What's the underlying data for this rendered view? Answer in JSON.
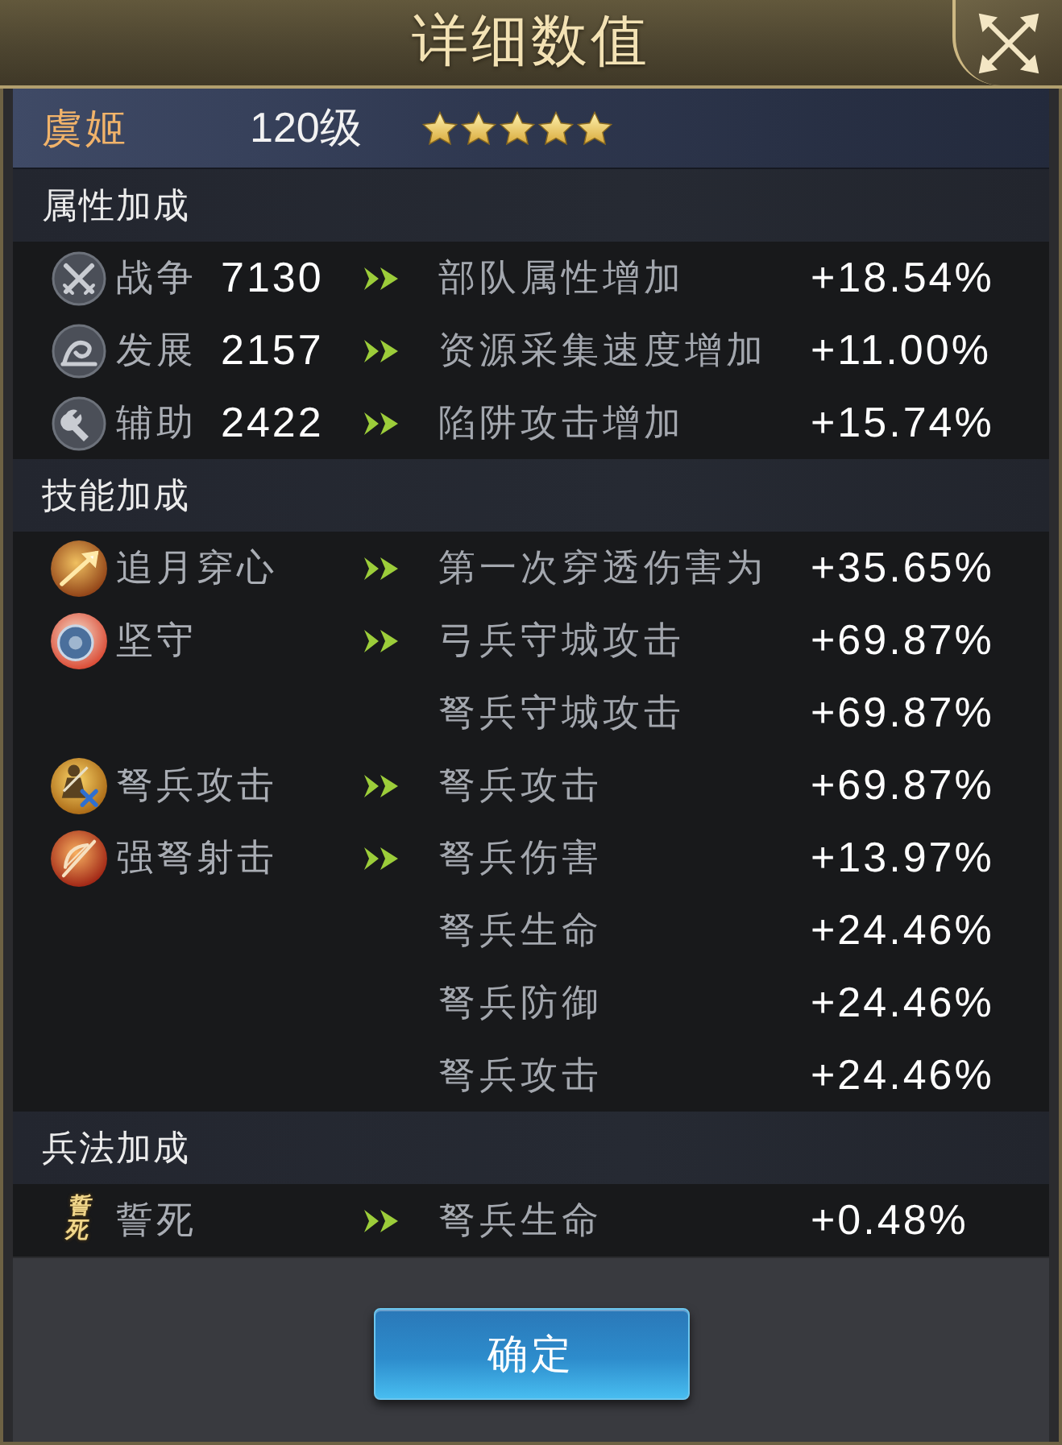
{
  "dialog": {
    "title": "详细数值"
  },
  "hero": {
    "name": "虞姬",
    "level": "120级",
    "stars": 5
  },
  "sections": [
    {
      "title": "属性加成",
      "rows": [
        {
          "kind": "attribute",
          "name": "战争",
          "value": "7130",
          "effects": [
            {
              "label": "部队属性增加",
              "amount": "+18.54%"
            }
          ]
        },
        {
          "kind": "attribute",
          "name": "发展",
          "value": "2157",
          "effects": [
            {
              "label": "资源采集速度增加",
              "amount": "+11.00%"
            }
          ]
        },
        {
          "kind": "attribute",
          "name": "辅助",
          "value": "2422",
          "effects": [
            {
              "label": "陷阱攻击增加",
              "amount": "+15.74%"
            }
          ]
        }
      ]
    },
    {
      "title": "技能加成",
      "rows": [
        {
          "kind": "skill",
          "name": "追月穿心",
          "effects": [
            {
              "label": "第一次穿透伤害为",
              "amount": "+35.65%"
            }
          ]
        },
        {
          "kind": "skill",
          "name": "坚守",
          "effects": [
            {
              "label": "弓兵守城攻击",
              "amount": "+69.87%"
            },
            {
              "label": "弩兵守城攻击",
              "amount": "+69.87%"
            }
          ]
        },
        {
          "kind": "skill",
          "name": "弩兵攻击",
          "effects": [
            {
              "label": "弩兵攻击",
              "amount": "+69.87%"
            }
          ]
        },
        {
          "kind": "skill",
          "name": "强弩射击",
          "effects": [
            {
              "label": "弩兵伤害",
              "amount": "+13.97%"
            },
            {
              "label": "弩兵生命",
              "amount": "+24.46%"
            },
            {
              "label": "弩兵防御",
              "amount": "+24.46%"
            },
            {
              "label": "弩兵攻击",
              "amount": "+24.46%"
            }
          ]
        }
      ]
    },
    {
      "title": "兵法加成",
      "rows": [
        {
          "kind": "tactic",
          "name": "誓死",
          "emblem": "誓死",
          "effects": [
            {
              "label": "弩兵生命",
              "amount": "+0.48%"
            }
          ]
        }
      ]
    }
  ],
  "confirm_button": "确定"
}
